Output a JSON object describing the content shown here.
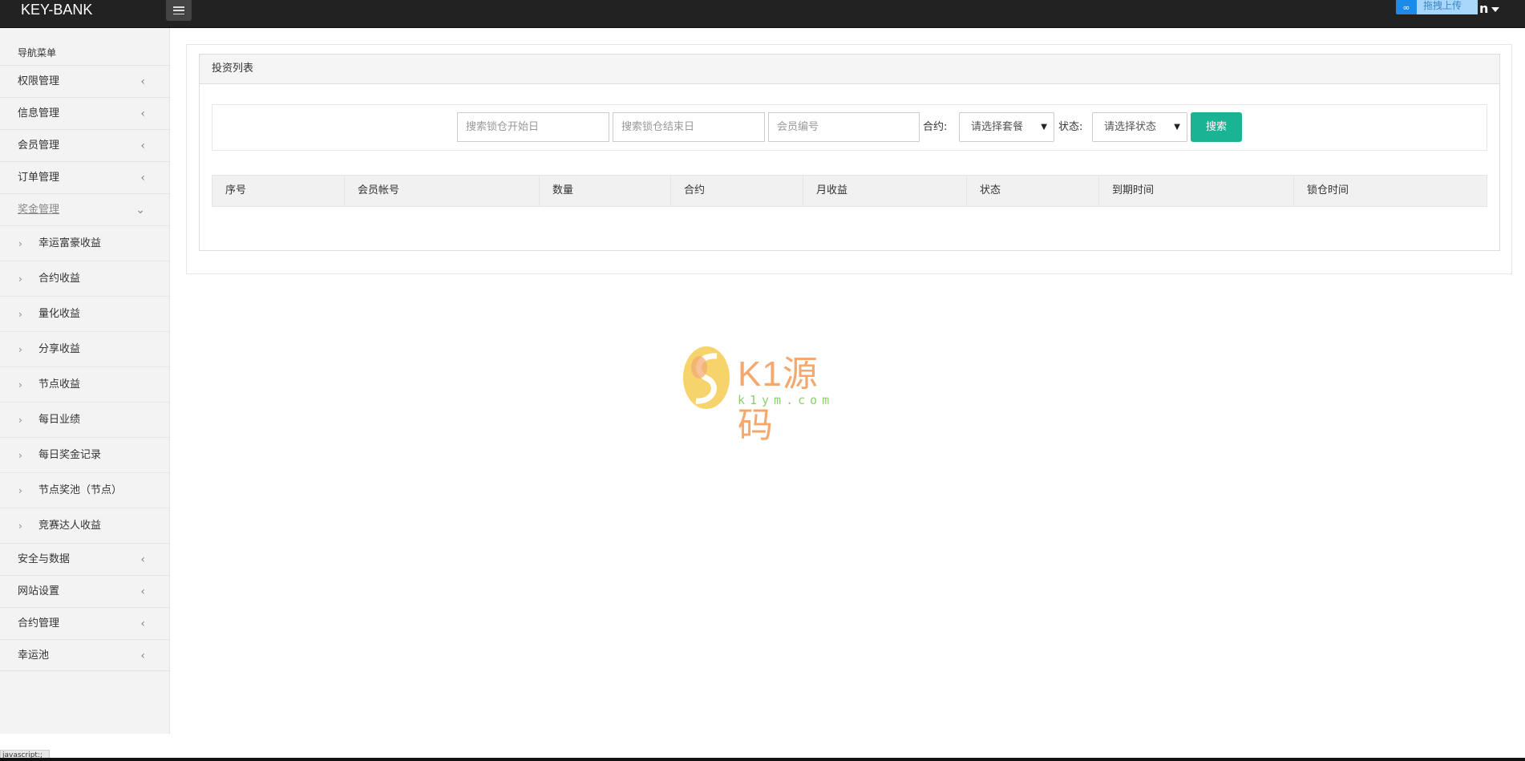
{
  "topbar": {
    "brand": "KEY-BANK",
    "upload_label": "拖拽上传",
    "user_label": "n"
  },
  "sidebar": {
    "header": "导航菜单",
    "items_top": [
      {
        "label": "权限管理"
      },
      {
        "label": "信息管理"
      },
      {
        "label": "会员管理"
      },
      {
        "label": "订单管理"
      }
    ],
    "active_item": {
      "label": "奖金管理"
    },
    "sub_items": [
      {
        "label": "幸运富豪收益"
      },
      {
        "label": "合约收益"
      },
      {
        "label": "量化收益"
      },
      {
        "label": "分享收益"
      },
      {
        "label": "节点收益"
      },
      {
        "label": "每日业绩"
      },
      {
        "label": "每日奖金记录"
      },
      {
        "label": "节点奖池（节点）"
      },
      {
        "label": "竞赛达人收益"
      }
    ],
    "items_bottom": [
      {
        "label": "安全与数据"
      },
      {
        "label": "网站设置"
      },
      {
        "label": "合约管理"
      },
      {
        "label": "幸运池"
      }
    ]
  },
  "panel": {
    "title": "投资列表"
  },
  "search": {
    "start_placeholder": "搜索锁仓开始日",
    "end_placeholder": "搜索锁仓结束日",
    "member_placeholder": "会员编号",
    "contract_label": "合约:",
    "contract_select": "请选择套餐",
    "status_label": "状态:",
    "status_select": "请选择状态",
    "button": "搜索"
  },
  "table": {
    "columns": [
      "序号",
      "会员帐号",
      "数量",
      "合约",
      "月收益",
      "状态",
      "到期时间",
      "锁仓时间"
    ]
  },
  "watermark": {
    "text": "K1源码",
    "url": "k1ym.com"
  },
  "statusbar": {
    "text": "javascript:;"
  }
}
